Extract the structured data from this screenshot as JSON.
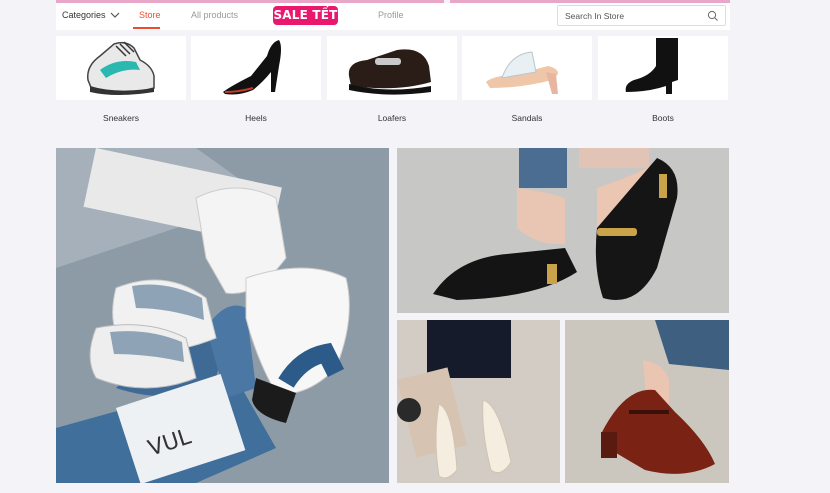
{
  "nav": {
    "categories_label": "Categories",
    "store_label": "Store",
    "all_products_label": "All products",
    "sale_badge": "SALE TẾT",
    "profile_label": "Profile",
    "search_placeholder": "Search In Store",
    "accent_color": "#ee4d2d",
    "sale_color": "#e9176e"
  },
  "categories": [
    {
      "label": "Sneakers",
      "icon": "sneaker-image"
    },
    {
      "label": "Heels",
      "icon": "heel-image"
    },
    {
      "label": "Loafers",
      "icon": "loafer-image"
    },
    {
      "label": "Sandals",
      "icon": "sandal-image"
    },
    {
      "label": "Boots",
      "icon": "boot-image"
    }
  ],
  "banners": {
    "main_caption": "VUL"
  }
}
